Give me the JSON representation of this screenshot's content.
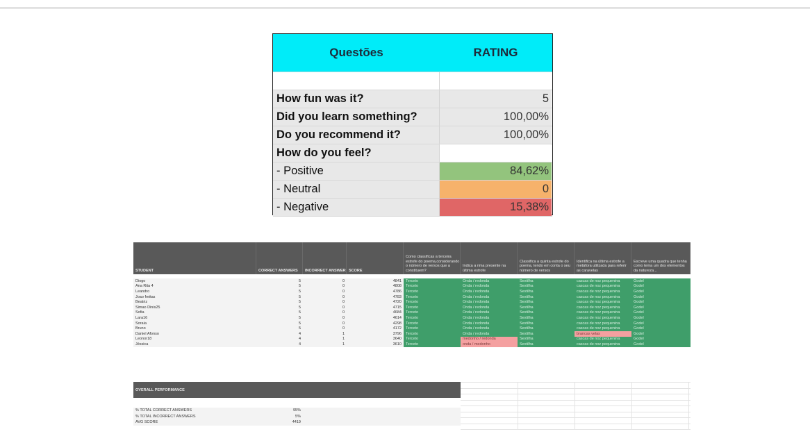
{
  "survey": {
    "header": {
      "question": "Questões",
      "rating": "RATING"
    },
    "rows": [
      {
        "label": "How fun was it?",
        "value": "5"
      },
      {
        "label": "Did you learn something?",
        "value": "100,00%"
      },
      {
        "label": "Do you recommend it?",
        "value": "100,00%"
      },
      {
        "label": "How do you feel?",
        "value": ""
      },
      {
        "label": "- Positive",
        "value": "84,62%",
        "color": "#93c47d"
      },
      {
        "label": "- Neutral",
        "value": "0",
        "color": "#f6b26b"
      },
      {
        "label": "- Negative",
        "value": "15,38%",
        "color": "#e06666"
      }
    ]
  },
  "results": {
    "columns": {
      "student": "STUDENT",
      "correct": "CORRECT ANSWERS",
      "incorrect": "INCORRECT ANSWERS",
      "score": "SCORE",
      "q1": "Como classificas a terceira estrofe do poema,considerando o número de versos que a constituem?",
      "q2": "Indica a rima presente na última estrofe",
      "q3": "Classifica a quinta estrofe do poema, tendo em conta o seu número de versos",
      "q4": "Identifica na última estrofe a metáfora utilizada para referir as caravelas",
      "q5": "Escreve uma quadra que tenha como tema um dos elementos da natureza..."
    },
    "students": [
      {
        "name": "Diogo",
        "correct": "5",
        "incorrect": "0",
        "score": "4841",
        "a1": "Terceto",
        "a2": "Onda / redonda",
        "a3": "Sextilha",
        "a4": "cascas de noz pequenina",
        "a5": "Godel"
      },
      {
        "name": "Ana Rita 4",
        "correct": "5",
        "incorrect": "0",
        "score": "4808",
        "a1": "Terceto",
        "a2": "Onda / redonda",
        "a3": "Sextilha",
        "a4": "cascas de noz pequenina",
        "a5": "Godel"
      },
      {
        "name": "Leandro",
        "correct": "5",
        "incorrect": "0",
        "score": "4786",
        "a1": "Terceto",
        "a2": "Onda / redonda",
        "a3": "Sextilha",
        "a4": "cascas de noz pequenina",
        "a5": "Godel"
      },
      {
        "name": "Joao freitas",
        "correct": "5",
        "incorrect": "0",
        "score": "4783",
        "a1": "Terceto",
        "a2": "Onda / redonda",
        "a3": "Sextilha",
        "a4": "cascas de noz pequenina",
        "a5": "Godel"
      },
      {
        "name": "Beatriz",
        "correct": "5",
        "incorrect": "0",
        "score": "4720",
        "a1": "Terceto",
        "a2": "Onda / redonda",
        "a3": "Sextilha",
        "a4": "cascas de noz pequenina",
        "a5": "Godel"
      },
      {
        "name": "Simao Dinis25",
        "correct": "5",
        "incorrect": "0",
        "score": "4715",
        "a1": "Terceto",
        "a2": "Onda / redonda",
        "a3": "Sextilha",
        "a4": "cascas de noz pequenina",
        "a5": "Godel"
      },
      {
        "name": "Sofia",
        "correct": "5",
        "incorrect": "0",
        "score": "4684",
        "a1": "Terceto",
        "a2": "Onda / redonda",
        "a3": "Sextilha",
        "a4": "cascas de noz pequenina",
        "a5": "Godel"
      },
      {
        "name": "Lara16",
        "correct": "5",
        "incorrect": "0",
        "score": "4614",
        "a1": "Terceto",
        "a2": "Onda / redonda",
        "a3": "Sextilha",
        "a4": "cascas de noz pequenina",
        "a5": "Godel"
      },
      {
        "name": "Soraia",
        "correct": "5",
        "incorrect": "0",
        "score": "4298",
        "a1": "Terceto",
        "a2": "Onda / redonda",
        "a3": "Sextilha",
        "a4": "cascas de noz pequenina",
        "a5": "Godel"
      },
      {
        "name": "Bruno",
        "correct": "5",
        "incorrect": "0",
        "score": "4172",
        "a1": "Terceto",
        "a2": "Onda / redonda",
        "a3": "Sextilha",
        "a4": "cascas de noz pequenina",
        "a5": "Godel"
      },
      {
        "name": "Daniel Afonso",
        "correct": "4",
        "incorrect": "1",
        "score": "3796",
        "a1": "Terceto",
        "a2": "Onda / redonda",
        "a3": "Sextilha",
        "a4": "brancas velas",
        "a4_wrong": true,
        "a5": "Godel"
      },
      {
        "name": "Leonor18",
        "correct": "4",
        "incorrect": "1",
        "score": "3640",
        "a1": "Terceto",
        "a2": "medonho / redonda",
        "a2_wrong": true,
        "a3": "Sextilha",
        "a4": "cascas de noz pequenina",
        "a5": "Godel"
      },
      {
        "name": "Jéssica",
        "correct": "4",
        "incorrect": "1",
        "score": "3610",
        "a1": "Terceto",
        "a2": "onda / medonho",
        "a2_wrong": true,
        "a3": "Sextilha",
        "a4": "cascas de noz pequenina",
        "a5": "Godel"
      }
    ],
    "overall_title": "OVERALL PERFORMANCE",
    "stats": [
      {
        "label": "% TOTAL CORRECT ANSWERS",
        "value": "95%"
      },
      {
        "label": "% TOTAL INCORRECT ANSWERS",
        "value": "5%"
      },
      {
        "label": "AVG SCORE",
        "value": "4419"
      }
    ]
  }
}
